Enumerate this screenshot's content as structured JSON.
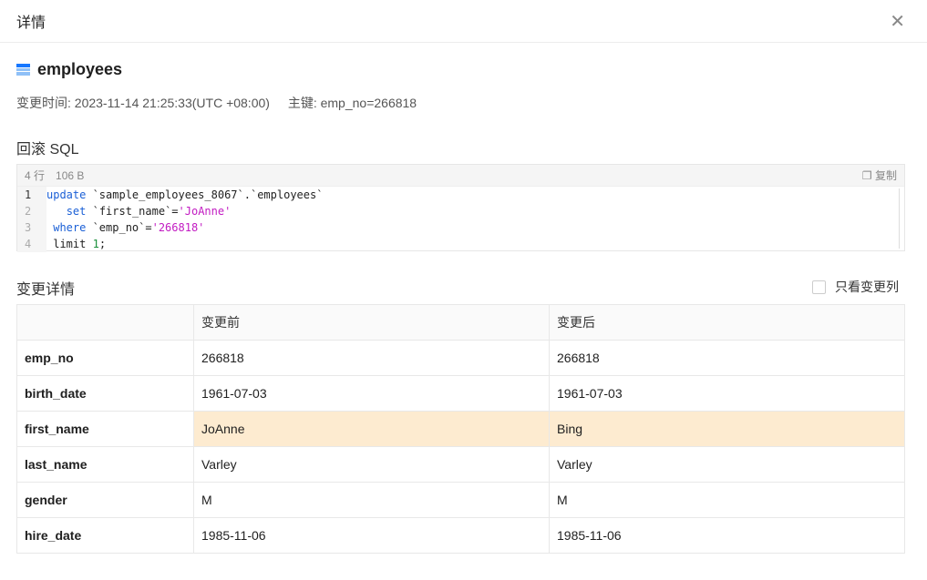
{
  "dialog": {
    "title": "详情"
  },
  "table_name": "employees",
  "meta": {
    "change_time": "变更时间: 2023-11-14 21:25:33(UTC +08:00)",
    "primary_key": "主键: emp_no=266818"
  },
  "rollback": {
    "title": "回滚 SQL",
    "lines_count": "4 行",
    "size": "106 B",
    "copy": "复制",
    "code": [
      [
        {
          "t": "update",
          "c": "kw"
        },
        {
          "t": " `sample_employees_8067`.`employees`"
        }
      ],
      [
        {
          "t": "   "
        },
        {
          "t": "set",
          "c": "kw"
        },
        {
          "t": " `first_name`="
        },
        {
          "t": "'JoAnne'",
          "c": "str"
        }
      ],
      [
        {
          "t": " "
        },
        {
          "t": "where",
          "c": "kw"
        },
        {
          "t": " `emp_no`="
        },
        {
          "t": "'266818'",
          "c": "str"
        }
      ],
      [
        {
          "t": " limit "
        },
        {
          "t": "1",
          "c": "num"
        },
        {
          "t": ";"
        }
      ]
    ]
  },
  "details": {
    "title": "变更详情",
    "only_changed": "只看变更列",
    "headers": [
      "",
      "变更前",
      "变更后"
    ],
    "rows": [
      {
        "field": "emp_no",
        "before": "266818",
        "after": "266818",
        "changed": false
      },
      {
        "field": "birth_date",
        "before": "1961-07-03",
        "after": "1961-07-03",
        "changed": false
      },
      {
        "field": "first_name",
        "before": "JoAnne",
        "after": "Bing",
        "changed": true
      },
      {
        "field": "last_name",
        "before": "Varley",
        "after": "Varley",
        "changed": false
      },
      {
        "field": "gender",
        "before": "M",
        "after": "M",
        "changed": false
      },
      {
        "field": "hire_date",
        "before": "1985-11-06",
        "after": "1985-11-06",
        "changed": false
      }
    ]
  }
}
